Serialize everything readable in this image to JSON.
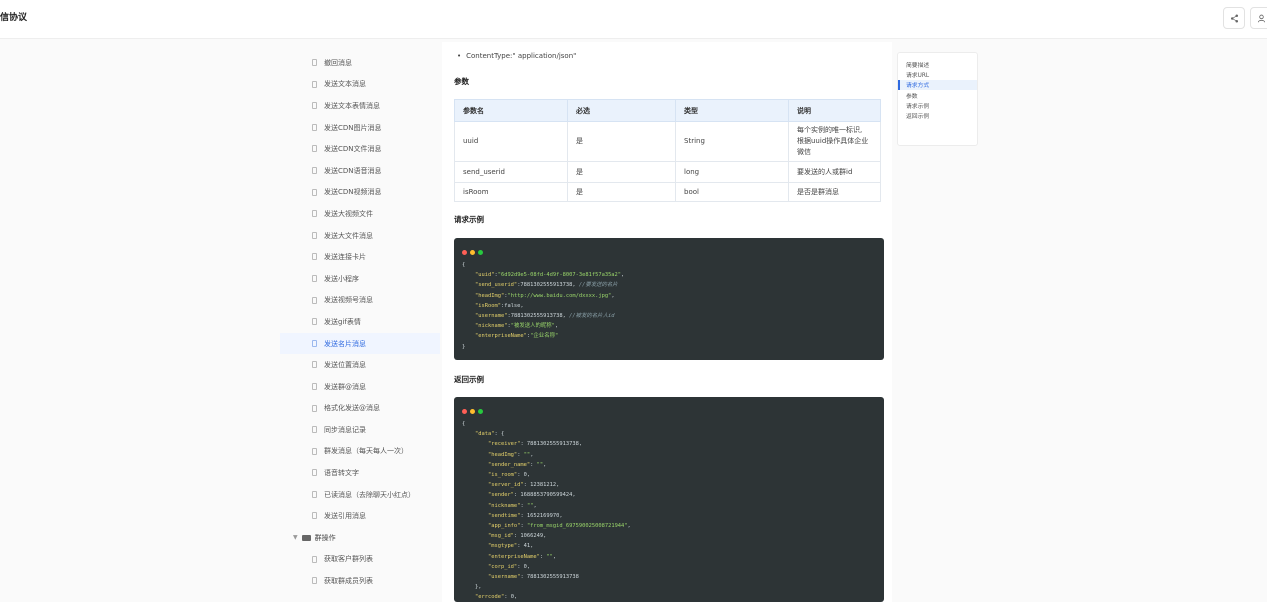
{
  "header": {
    "title": "信协议"
  },
  "sidebar": {
    "items": [
      {
        "label": "撤回消息"
      },
      {
        "label": "发送文本消息"
      },
      {
        "label": "发送文本表情消息"
      },
      {
        "label": "发送CDN图片消息"
      },
      {
        "label": "发送CDN文件消息"
      },
      {
        "label": "发送CDN语音消息"
      },
      {
        "label": "发送CDN视频消息"
      },
      {
        "label": "发送大视频文件"
      },
      {
        "label": "发送大文件消息"
      },
      {
        "label": "发送连接卡片"
      },
      {
        "label": "发送小程序"
      },
      {
        "label": "发送视频号消息"
      },
      {
        "label": "发送gif表情"
      },
      {
        "label": "发送名片消息"
      },
      {
        "label": "发送位置消息"
      },
      {
        "label": "发送群@消息"
      },
      {
        "label": "格式化发送@消息"
      },
      {
        "label": "同步消息记录"
      },
      {
        "label": "群发消息（每天每人一次）"
      },
      {
        "label": "语音转文字"
      },
      {
        "label": "已读消息（去除聊天小红点）"
      },
      {
        "label": "发送引用消息"
      }
    ],
    "active_index": 13,
    "group": {
      "label": "群操作"
    },
    "group_items": [
      {
        "label": "获取客户群列表"
      },
      {
        "label": "获取群成员列表"
      }
    ]
  },
  "content": {
    "bullet": "ContentType:\" application/json\"",
    "params_heading": "参数",
    "table": {
      "headers": [
        "参数名",
        "必选",
        "类型",
        "说明"
      ],
      "rows": [
        [
          "uuid",
          "是",
          "String",
          "每个实例的唯一标识,\n根据uuid操作具体企业微信"
        ],
        [
          "send_userid",
          "是",
          "long",
          "要发送的人或群id"
        ],
        [
          "isRoom",
          "是",
          "bool",
          "是否是群消息"
        ]
      ]
    },
    "request_heading": "请求示例",
    "response_heading": "返回示例"
  },
  "toc": {
    "items": [
      "简要描述",
      "请求URL",
      "请求方式",
      "参数",
      "请求示例",
      "返回示例"
    ],
    "active_index": 2
  },
  "colors": {
    "accent": "#2f6ae0",
    "code_bg": "#2d3436",
    "dot_red": "#ff5f56",
    "dot_yellow": "#ffbd2e",
    "dot_green": "#27c93f"
  }
}
